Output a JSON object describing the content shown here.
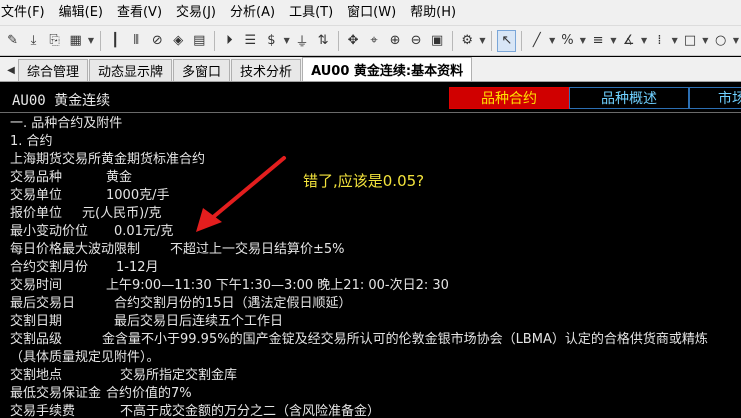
{
  "menu": [
    "文件(F)",
    "编辑(E)",
    "查看(V)",
    "交易(J)",
    "分析(A)",
    "工具(T)",
    "窗口(W)",
    "帮助(H)"
  ],
  "tabs": [
    {
      "label": "综合管理",
      "active": false
    },
    {
      "label": "动态显示牌",
      "active": false
    },
    {
      "label": "多窗口",
      "active": false
    },
    {
      "label": "技术分析",
      "active": false
    },
    {
      "label": "AU00 黄金连续:基本资料",
      "active": true
    }
  ],
  "header": {
    "title": "AU00  黄金连续",
    "tabs": [
      "品种合约",
      "品种概述",
      "市场"
    ]
  },
  "content": {
    "section": "一.  品种合约及附件",
    "subsection": "1. 合约",
    "contract_title": "上海期货交易所黄金期货标准合约",
    "rows": [
      {
        "label": "交易品种",
        "value": "黄金"
      },
      {
        "label": "交易单位",
        "value": "1000克/手"
      },
      {
        "label": "报价单位",
        "value": "元(人民币)/克"
      },
      {
        "label": "最小变动价位",
        "value": "0.01元/克"
      },
      {
        "label": "每日价格最大波动限制",
        "value": "不超过上一交易日结算价±5%"
      },
      {
        "label": "合约交割月份",
        "value": "1-12月"
      },
      {
        "label": "交易时间",
        "value": "上午9:00—11:30 下午1:30—3:00 晚上21: 00-次日2: 30"
      },
      {
        "label": "最后交易日",
        "value": "合约交割月份的15日（遇法定假日顺延）"
      },
      {
        "label": "交割日期",
        "value": "最后交易日后连续五个工作日"
      },
      {
        "label": "交割品级",
        "value": "金含量不小于99.95%的国产金锭及经交易所认可的伦敦金银市场协会（LBMA）认定的合格供货商或精炼"
      },
      {
        "label": "",
        "value": "（具体质量规定见附件）。"
      },
      {
        "label": "交割地点",
        "value": "交易所指定交割金库"
      },
      {
        "label": "最低交易保证金",
        "value": "合约价值的7%"
      },
      {
        "label": "交易手续费",
        "value": "不高于成交金额的万分之二（含风险准备金）"
      }
    ]
  },
  "annotation": "错了,应该是0.05?",
  "colors": {
    "header_active_bg": "#d00000",
    "header_active_text": "#ffe000",
    "header_tab_text": "#6fd0ff",
    "annotation": "#f3e33c",
    "arrow": "#e31e1e"
  }
}
